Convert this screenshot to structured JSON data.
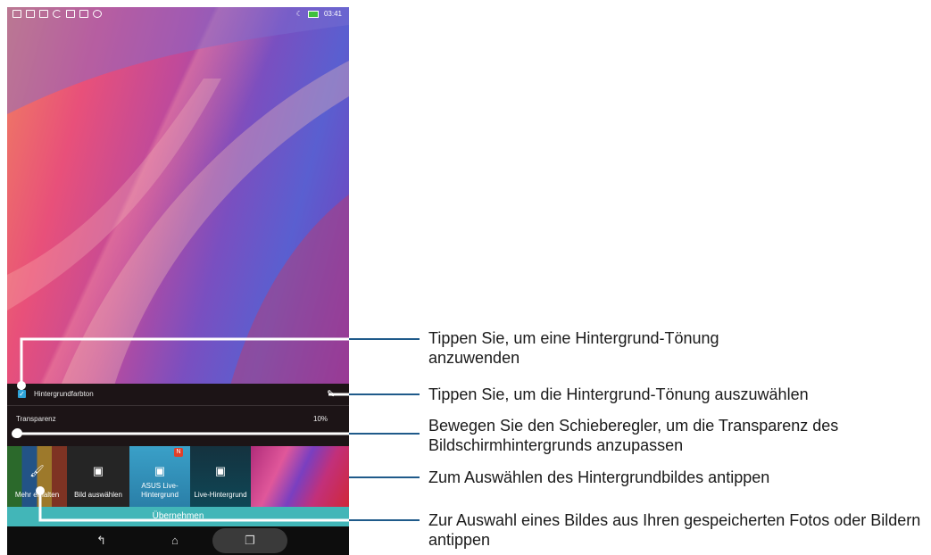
{
  "status_bar": {
    "time": "03:41",
    "icons": [
      "notification-icon",
      "notification-icon",
      "notification-icon",
      "moon-icon",
      "notification-icon",
      "sd-card-icon",
      "notification-icon"
    ]
  },
  "panel": {
    "tint_checkbox_checked": true,
    "tint_label": "Hintergrundfarbton",
    "transparency_label": "Transparenz",
    "transparency_value": "10%",
    "transparency_fraction": 0.1
  },
  "wallpaper_options": [
    {
      "label": "Mehr erhalten",
      "icon": "brush-icon"
    },
    {
      "label": "Bild auswählen",
      "icon": "gallery-icon"
    },
    {
      "label": "ASUS Live-Hintergrund",
      "icon": "live-wallpaper-icon",
      "badge": "N"
    },
    {
      "label": "Live-Hintergrund",
      "icon": "live-wallpaper-icon"
    },
    {
      "label": "",
      "icon": ""
    }
  ],
  "apply_button": "Übernehmen",
  "nav": {
    "back": "back-icon",
    "home": "home-icon",
    "recent": "recent-apps-icon"
  },
  "callouts": [
    {
      "text": "Tippen Sie, um eine Hintergrund-Tönung anzuwenden"
    },
    {
      "text": "Tippen Sie, um die Hintergrund-Tönung auszuwählen"
    },
    {
      "text": "Bewegen Sie den Schieberegler, um die Transparenz des Bildschirmhintergrunds anzupassen"
    },
    {
      "text": "Zum Auswählen des Hintergrundbildes antippen"
    },
    {
      "text": "Zur Auswahl eines Bildes aus Ihren gespeicherten Fotos oder Bildern antippen"
    }
  ],
  "colors": {
    "accent": "#42b6b8",
    "callout_line": "#1f5a8a",
    "checkbox": "#2ea3d8"
  }
}
